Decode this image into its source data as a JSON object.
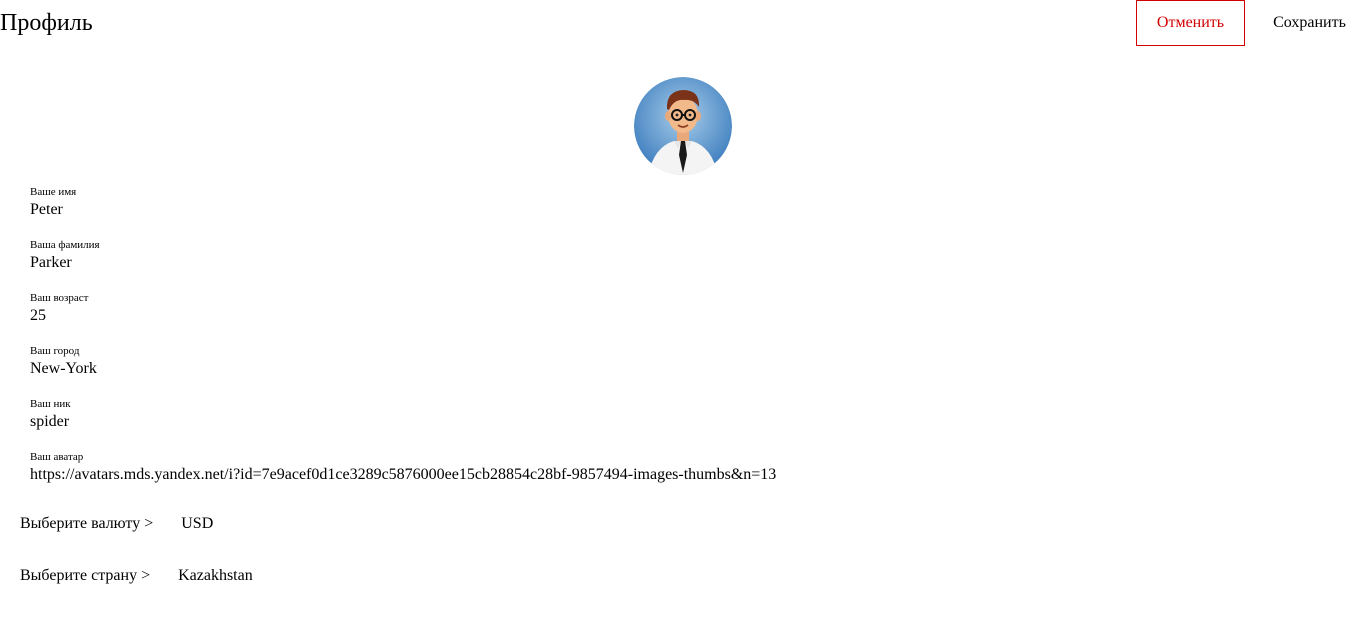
{
  "header": {
    "title": "Профиль",
    "cancel_label": "Отменить",
    "save_label": "Сохранить"
  },
  "colors": {
    "cancel_accent": "#d40000"
  },
  "avatar": {
    "icon": "user-avatar-icon"
  },
  "fields": [
    {
      "label": "Ваше имя",
      "value": "Peter"
    },
    {
      "label": "Ваша фамилия",
      "value": "Parker"
    },
    {
      "label": "Ваш возраст",
      "value": "25"
    },
    {
      "label": "Ваш город",
      "value": "New-York"
    },
    {
      "label": "Ваш ник",
      "value": "spider"
    },
    {
      "label": "Ваш аватар",
      "value": "https://avatars.mds.yandex.net/i?id=7e9acef0d1ce3289c5876000ee15cb28854c28bf-9857494-images-thumbs&n=13"
    }
  ],
  "currency": {
    "label": "Выберите валюту >",
    "value": "USD"
  },
  "country": {
    "label": "Выберите страну >",
    "value": "Kazakhstan"
  }
}
